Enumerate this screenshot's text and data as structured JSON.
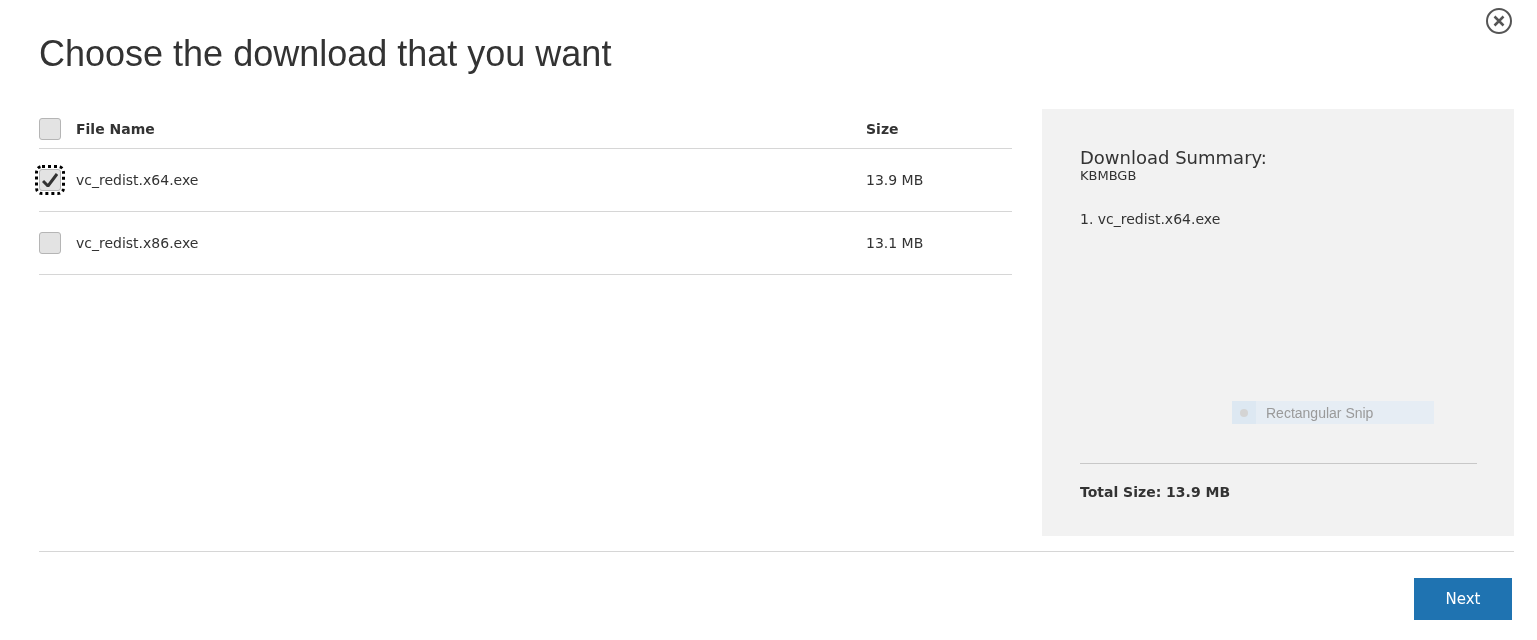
{
  "title": "Choose the download that you want",
  "table": {
    "select_all": {
      "checked": false
    },
    "columns": [
      "File Name",
      "Size"
    ],
    "rows": [
      {
        "name": "vc_redist.x64.exe",
        "size": "13.9 MB",
        "checked": true,
        "focused": true
      },
      {
        "name": "vc_redist.x86.exe",
        "size": "13.1 MB",
        "checked": false,
        "focused": false
      }
    ]
  },
  "summary": {
    "heading": "Download Summary:",
    "subheading": "KBMBGB",
    "items": [
      "1. vc_redist.x64.exe"
    ],
    "overlay_item": "Rectangular Snip",
    "total": "Total Size: 13.9 MB"
  },
  "buttons": [
    "Next"
  ]
}
